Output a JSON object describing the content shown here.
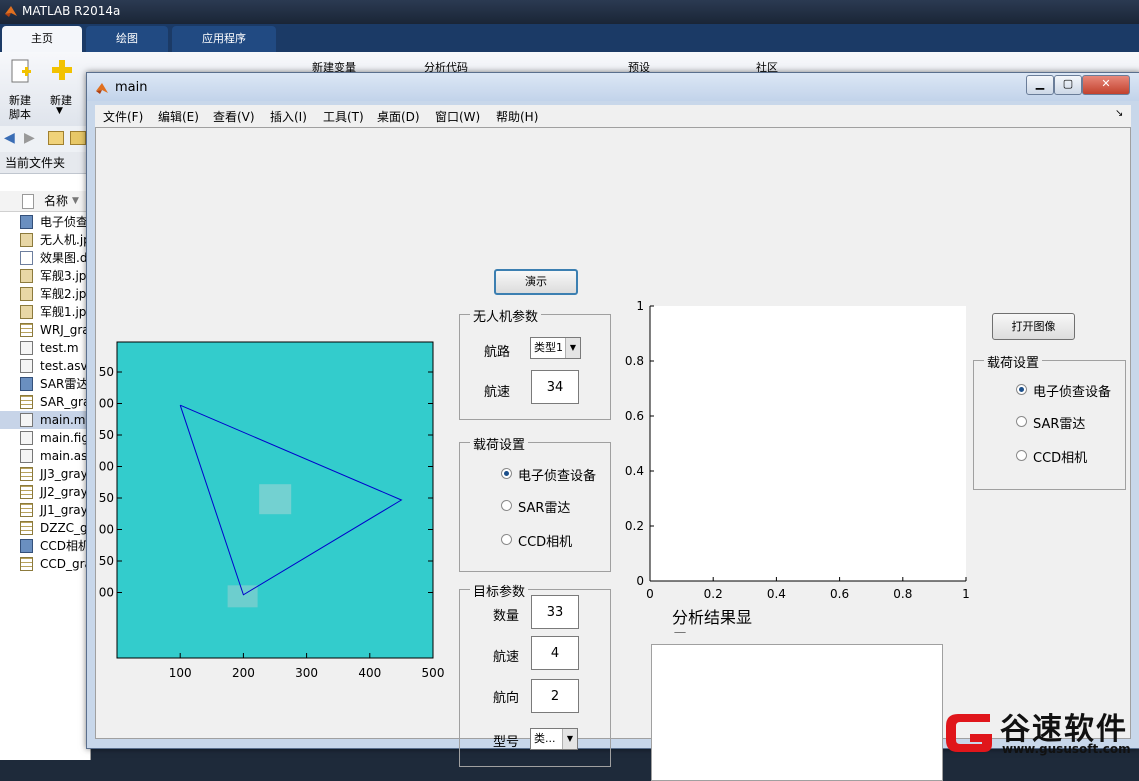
{
  "matlab": {
    "title": "MATLAB R2014a",
    "tabs": [
      "主页",
      "绘图",
      "应用程序"
    ],
    "ribbon": {
      "new_script_1": "新建",
      "new_script_2": "脚本",
      "new": "新建",
      "new_variable": "新建变量",
      "analyze_code": "分析代码",
      "preferences": "预设",
      "community": "社区"
    },
    "current_folder_label": "当前文件夹",
    "name_column": "名称",
    "files": [
      {
        "name": "电子侦查",
        "icon": "mat"
      },
      {
        "name": "无人机.jp",
        "icon": "img"
      },
      {
        "name": "效果图.d",
        "icon": "doc"
      },
      {
        "name": "军舰3.jp",
        "icon": "img"
      },
      {
        "name": "军舰2.jp",
        "icon": "img"
      },
      {
        "name": "军舰1.jp",
        "icon": "img"
      },
      {
        "name": "WRJ_gra",
        "icon": "grid"
      },
      {
        "name": "test.m",
        "icon": "fig"
      },
      {
        "name": "test.asv",
        "icon": "fig"
      },
      {
        "name": "SAR雷达",
        "icon": "mat"
      },
      {
        "name": "SAR_gra",
        "icon": "grid"
      },
      {
        "name": "main.m",
        "icon": "fig"
      },
      {
        "name": "main.fig",
        "icon": "fig"
      },
      {
        "name": "main.as",
        "icon": "fig"
      },
      {
        "name": "JJ3_gray",
        "icon": "grid"
      },
      {
        "name": "JJ2_gray",
        "icon": "grid"
      },
      {
        "name": "JJ1_gray",
        "icon": "grid"
      },
      {
        "name": "DZZC_gi",
        "icon": "grid"
      },
      {
        "name": "CCD相机",
        "icon": "mat"
      },
      {
        "name": "CCD_gra",
        "icon": "grid"
      }
    ],
    "selected_file_index": 11
  },
  "gui": {
    "title": "main",
    "menus": [
      "文件(F)",
      "编辑(E)",
      "查看(V)",
      "插入(I)",
      "工具(T)",
      "桌面(D)",
      "窗口(W)",
      "帮助(H)"
    ],
    "demo_button": "演示",
    "open_image_button": "打开图像",
    "uav_panel": {
      "title": "无人机参数",
      "route_label": "航路",
      "route_value": "类型1",
      "speed_label": "航速",
      "speed_value": "34"
    },
    "payload_panel_1": {
      "title": "载荷设置",
      "options": [
        "电子侦查设备",
        "SAR雷达",
        "CCD相机"
      ],
      "selected": 0
    },
    "payload_panel_2": {
      "title": "载荷设置",
      "options": [
        "电子侦查设备",
        "SAR雷达",
        "CCD相机"
      ],
      "selected": 0
    },
    "target_panel": {
      "title": "目标参数",
      "count_label": "数量",
      "count_value": "33",
      "speed_label": "航速",
      "speed_value": "4",
      "heading_label": "航向",
      "heading_value": "2",
      "model_label": "型号",
      "model_value": "类..."
    },
    "result_label": "分析结果显示:",
    "colors": {
      "plot_bg": "#33cccc",
      "route_line": "#0000cc",
      "client_bg": "#f0f0f0"
    }
  },
  "chart_data": [
    {
      "type": "line",
      "x_ticks": [
        "100",
        "200",
        "300",
        "400",
        "500"
      ],
      "y_ticks": [
        "50",
        "00",
        "50",
        "00",
        "50",
        "00",
        "50",
        "00"
      ],
      "xlim": [
        0,
        500
      ],
      "ylim": [
        0,
        500
      ],
      "series": [
        {
          "x": [
            100,
            450,
            200,
            100
          ],
          "y": [
            400,
            250,
            100,
            400
          ]
        }
      ],
      "background_color": "#33cccc"
    },
    {
      "type": "line",
      "x_ticks": [
        "0",
        "0.2",
        "0.4",
        "0.6",
        "0.8",
        "1"
      ],
      "y_ticks": [
        "0",
        "0.2",
        "0.4",
        "0.6",
        "0.8",
        "1"
      ],
      "xlim": [
        0,
        1
      ],
      "ylim": [
        0,
        1
      ],
      "series": []
    }
  ],
  "watermark": {
    "text": "谷速软件",
    "url": "www.gususoft.com"
  }
}
